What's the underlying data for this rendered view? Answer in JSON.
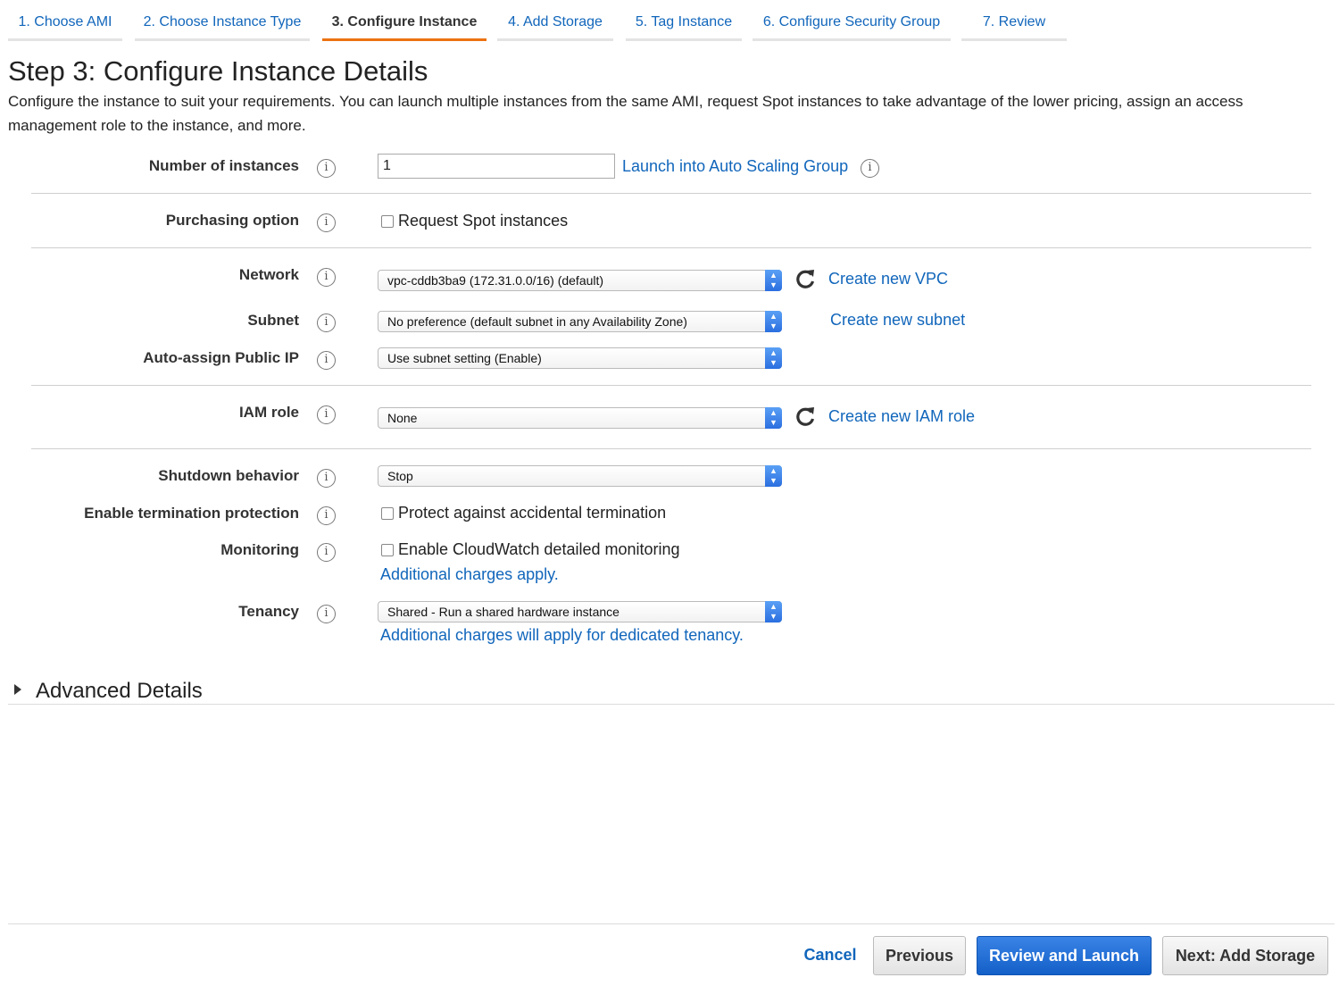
{
  "tabs": [
    {
      "label": "1. Choose AMI"
    },
    {
      "label": "2. Choose Instance Type"
    },
    {
      "label": "3. Configure Instance"
    },
    {
      "label": "4. Add Storage"
    },
    {
      "label": "5. Tag Instance"
    },
    {
      "label": "6. Configure Security Group"
    },
    {
      "label": "7. Review"
    }
  ],
  "page": {
    "title": "Step 3: Configure Instance Details",
    "intro": "Configure the instance to suit your requirements. You can launch multiple instances from the same AMI, request Spot instances to take advantage of the lower pricing, assign an access management role to the instance, and more."
  },
  "info_icon": "i",
  "form": {
    "instances": {
      "label": "Number of instances",
      "value": "1",
      "link": "Launch into Auto Scaling Group"
    },
    "purchasing": {
      "label": "Purchasing option",
      "checkbox": "Request Spot instances"
    },
    "network": {
      "label": "Network",
      "value": "vpc-cddb3ba9 (172.31.0.0/16) (default)",
      "link": "Create new VPC"
    },
    "subnet": {
      "label": "Subnet",
      "value": "No preference (default subnet in any Availability Zone)",
      "link": "Create new subnet"
    },
    "public_ip": {
      "label": "Auto-assign Public IP",
      "value": "Use subnet setting (Enable)"
    },
    "iam": {
      "label": "IAM role",
      "value": "None",
      "link": "Create new IAM role"
    },
    "shutdown": {
      "label": "Shutdown behavior",
      "value": "Stop"
    },
    "termination": {
      "label": "Enable termination protection",
      "checkbox": "Protect against accidental termination"
    },
    "monitoring": {
      "label": "Monitoring",
      "checkbox": "Enable CloudWatch detailed monitoring",
      "note": "Additional charges apply."
    },
    "tenancy": {
      "label": "Tenancy",
      "value": "Shared - Run a shared hardware instance",
      "note": "Additional charges will apply for dedicated tenancy."
    }
  },
  "advanced": {
    "label": "Advanced Details"
  },
  "footer": {
    "cancel": "Cancel",
    "previous": "Previous",
    "review_launch": "Review and Launch",
    "next": "Next: Add Storage"
  },
  "colors": {
    "accent_tab": "#ec7211",
    "link": "#1166bb",
    "primary_button": "#1d6fd6"
  },
  "icons": [
    "info-icon",
    "refresh-icon",
    "select-arrows-icon",
    "caret-right-icon"
  ]
}
